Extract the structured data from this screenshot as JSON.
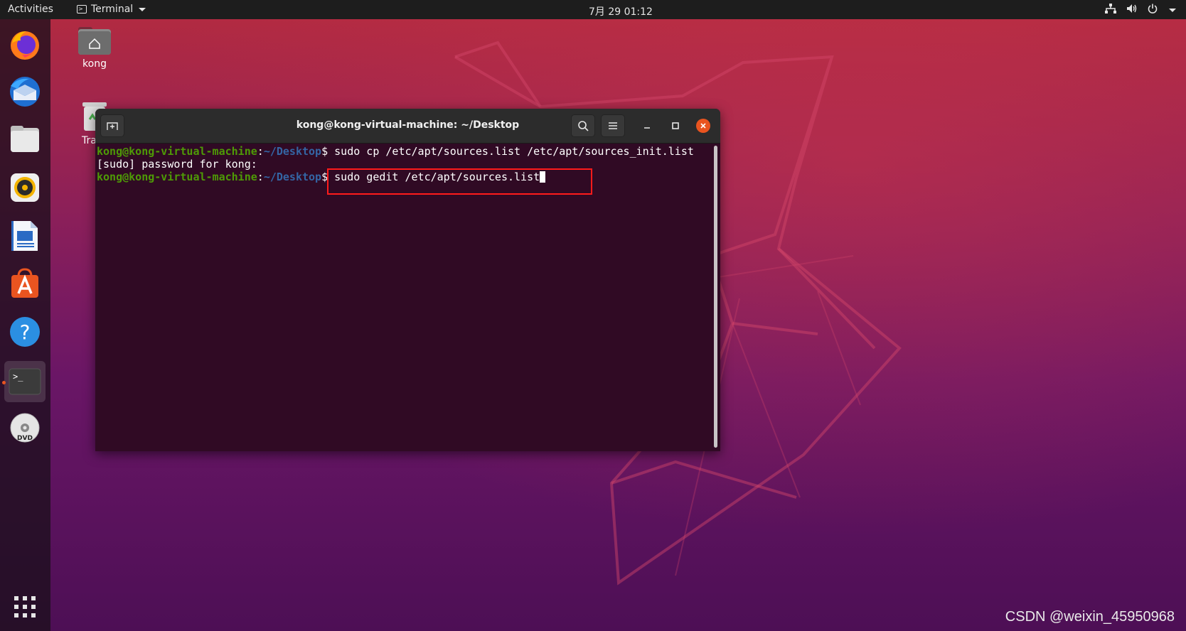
{
  "topbar": {
    "activities": "Activities",
    "app_name": "Terminal",
    "clock": "7月 29  01:12"
  },
  "dock": {
    "items": [
      {
        "name": "firefox-icon"
      },
      {
        "name": "thunderbird-icon"
      },
      {
        "name": "files-icon"
      },
      {
        "name": "rhythmbox-icon"
      },
      {
        "name": "writer-icon"
      },
      {
        "name": "software-icon"
      },
      {
        "name": "help-icon"
      },
      {
        "name": "terminal-icon",
        "active": true
      },
      {
        "name": "dvd-icon"
      }
    ],
    "apps_grid": "show-applications-icon"
  },
  "desktop": {
    "home_label": "kong",
    "trash_label": "Tra"
  },
  "terminal": {
    "title": "kong@kong-virtual-machine: ~/Desktop",
    "lines": [
      {
        "user": "kong@kong-virtual-machine",
        "sep": ":",
        "path": "~/Desktop",
        "prompt": "$ ",
        "cmd": "sudo cp /etc/apt/sources.list /etc/apt/sources_init.list"
      },
      {
        "text": "[sudo] password for kong:"
      },
      {
        "user": "kong@kong-virtual-machine",
        "sep": ":",
        "path": "~/Desktop",
        "prompt": "$ ",
        "cmd": "sudo gedit /etc/apt/sources.list"
      }
    ]
  },
  "watermark": "CSDN @weixin_45950968",
  "colors": {
    "ubuntu_orange": "#e95420",
    "terminal_bg": "#300a24",
    "prompt_green": "#4e9a06",
    "prompt_blue": "#3465a4",
    "highlight_red": "#ff1b1b"
  }
}
